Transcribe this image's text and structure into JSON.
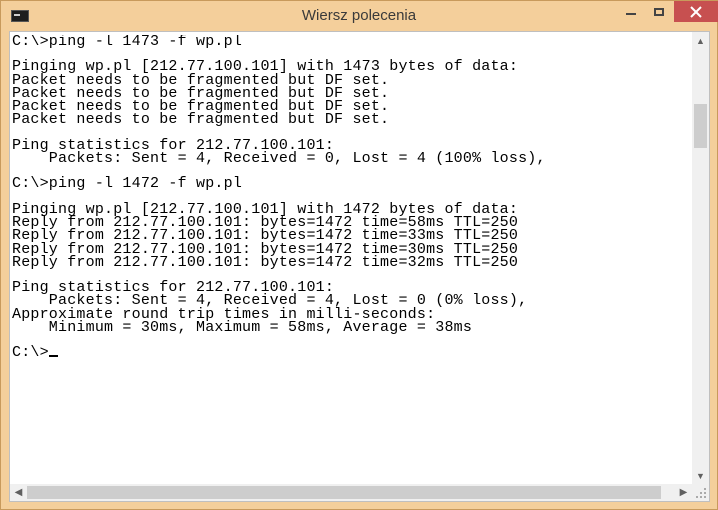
{
  "window": {
    "title": "Wiersz polecenia",
    "icon": "console-icon",
    "controls": [
      "minimize-icon",
      "maximize-icon",
      "close-icon"
    ],
    "accent_color": "#f4cf9b",
    "close_color": "#c75050"
  },
  "console": {
    "lines": [
      "C:\\>ping -l 1473 -f wp.pl",
      "",
      "Pinging wp.pl [212.77.100.101] with 1473 bytes of data:",
      "Packet needs to be fragmented but DF set.",
      "Packet needs to be fragmented but DF set.",
      "Packet needs to be fragmented but DF set.",
      "Packet needs to be fragmented but DF set.",
      "",
      "Ping statistics for 212.77.100.101:",
      "    Packets: Sent = 4, Received = 0, Lost = 4 (100% loss),",
      "",
      "C:\\>ping -l 1472 -f wp.pl",
      "",
      "Pinging wp.pl [212.77.100.101] with 1472 bytes of data:",
      "Reply from 212.77.100.101: bytes=1472 time=58ms TTL=250",
      "Reply from 212.77.100.101: bytes=1472 time=33ms TTL=250",
      "Reply from 212.77.100.101: bytes=1472 time=30ms TTL=250",
      "Reply from 212.77.100.101: bytes=1472 time=32ms TTL=250",
      "",
      "Ping statistics for 212.77.100.101:",
      "    Packets: Sent = 4, Received = 4, Lost = 0 (0% loss),",
      "Approximate round trip times in milli-seconds:",
      "    Minimum = 30ms, Maximum = 58ms, Average = 38ms",
      "",
      "C:\\>"
    ]
  },
  "scrollbars": {
    "vertical": {
      "up_icon": "chevron-up-icon",
      "down_icon": "chevron-down-icon"
    },
    "horizontal": {
      "left_icon": "chevron-left-icon",
      "right_icon": "chevron-right-icon"
    }
  }
}
